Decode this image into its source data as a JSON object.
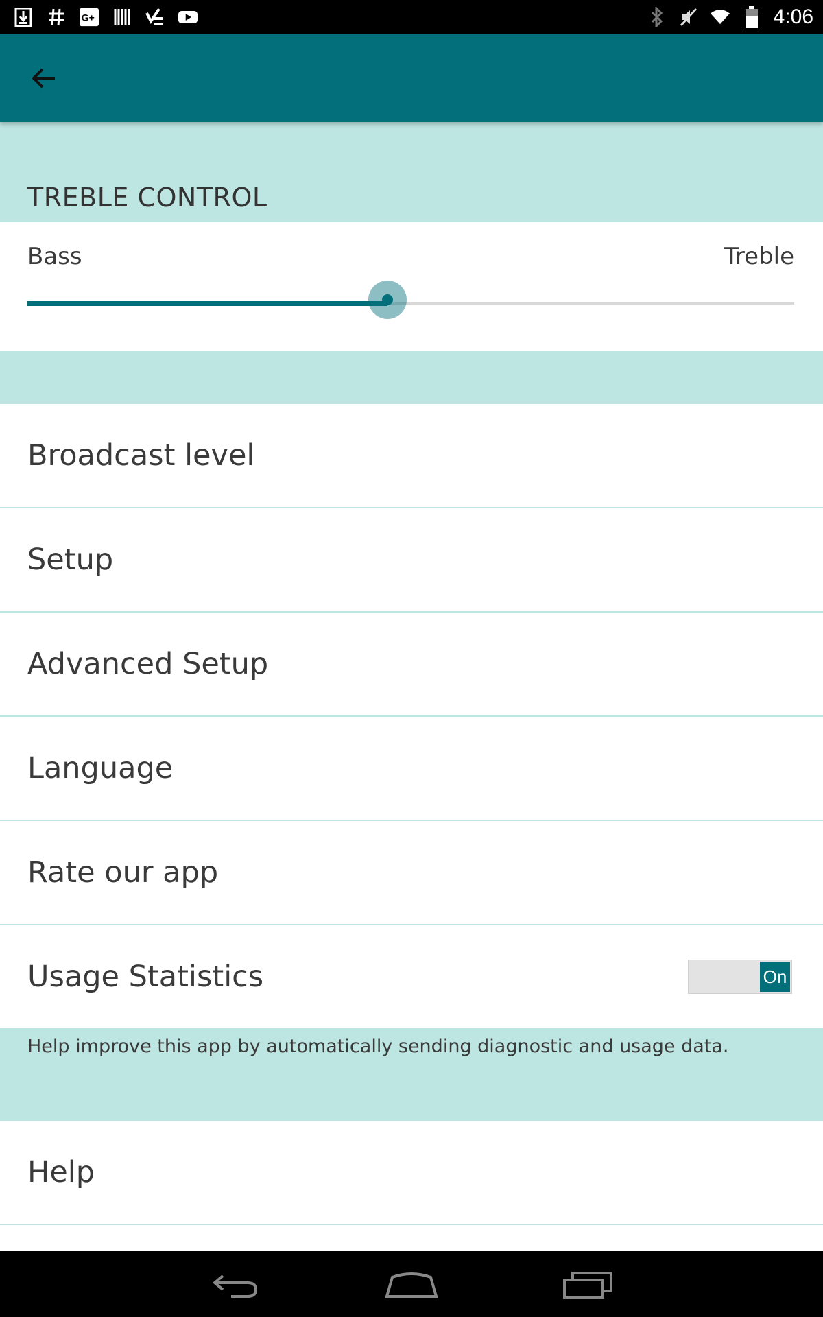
{
  "status_bar": {
    "time": "4:06",
    "left_icons": [
      "download-icon",
      "hashtag-icon",
      "google-plus-icon",
      "barcode-icon",
      "tasks-icon",
      "youtube-icon"
    ],
    "right_icons": [
      "bluetooth-icon",
      "mute-icon",
      "wifi-icon",
      "battery-icon"
    ]
  },
  "toolbar": {
    "back_icon": "arrow-back-icon"
  },
  "treble_section": {
    "title": "TREBLE CONTROL",
    "left_label": "Bass",
    "right_label": "Treble",
    "slider_value": 0.47
  },
  "menu": {
    "broadcast_level": "Broadcast level",
    "setup": "Setup",
    "advanced_setup": "Advanced Setup",
    "language": "Language",
    "rate_app": "Rate our app",
    "usage_statistics": "Usage Statistics",
    "usage_toggle_label": "On",
    "usage_description": "Help improve this app by automatically sending diagnostic and usage data.",
    "help": "Help"
  },
  "nav_bar": {
    "buttons": [
      "back-nav-icon",
      "home-nav-icon",
      "recents-nav-icon"
    ]
  },
  "colors": {
    "primary": "#036f7a",
    "section_background": "#bde5e1"
  }
}
